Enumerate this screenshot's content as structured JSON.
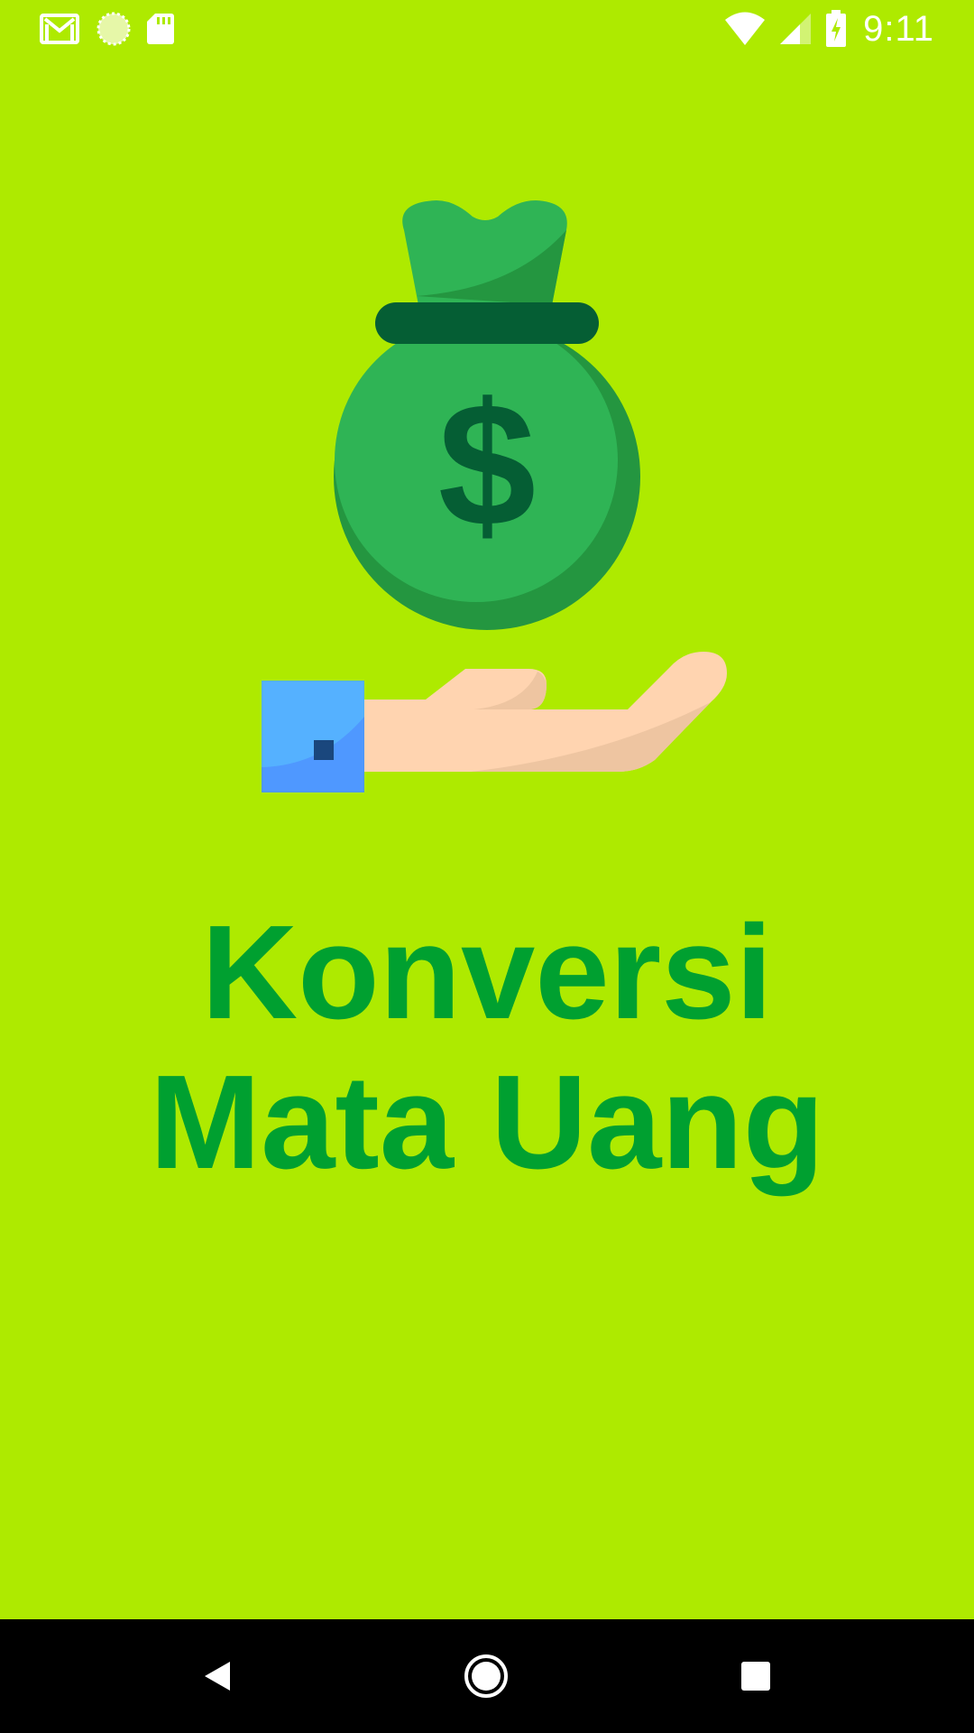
{
  "status_bar": {
    "time": "9:11",
    "notifications": [
      "gmail-icon",
      "sync-circle-icon",
      "sd-card-icon"
    ],
    "indicators": [
      "wifi-icon",
      "cellular-signal-icon",
      "battery-charging-icon"
    ]
  },
  "splash": {
    "title_line1": "Konversi",
    "title_line2": "Mata Uang",
    "illustration": "money-bag-on-hand-illustration",
    "background_color": "#AEEA00",
    "title_color": "#00A030"
  },
  "nav_bar": {
    "buttons": [
      "back-icon",
      "home-icon",
      "recents-icon"
    ]
  }
}
